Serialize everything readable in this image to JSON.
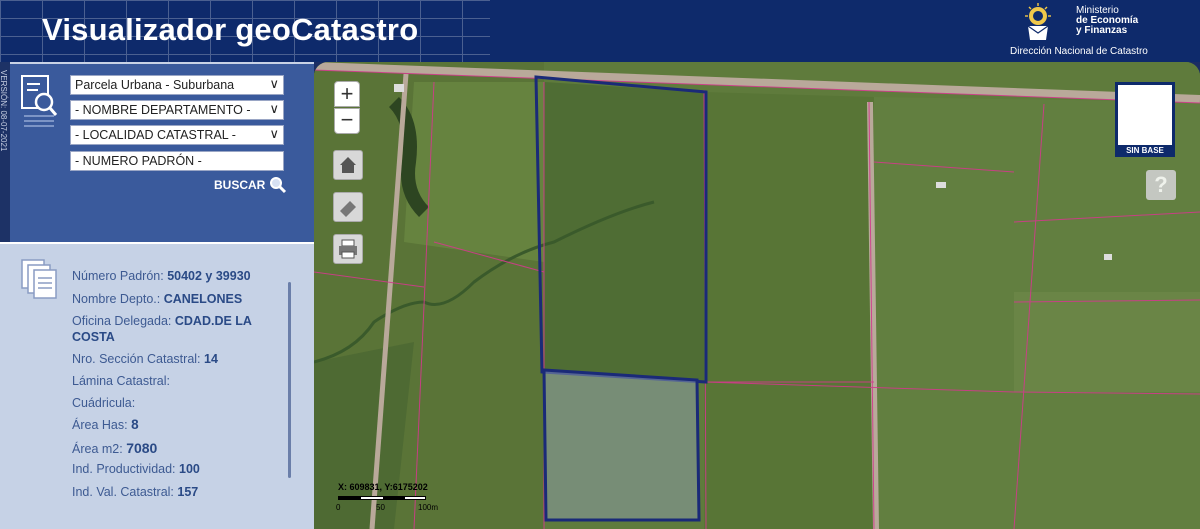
{
  "header": {
    "title": "Visualizador geoCatastro",
    "ministry_line1": "Ministerio",
    "ministry_line2": "de Economía",
    "ministry_line3": "y Finanzas",
    "dept": "Dirección Nacional de Catastro"
  },
  "sidebar": {
    "version": "VERSIÓN: 08-07-2021",
    "filters": [
      {
        "value": "Parcela Urbana - Suburbana",
        "has_dropdown": true
      },
      {
        "value": "- NOMBRE DEPARTAMENTO -",
        "has_dropdown": true
      },
      {
        "value": "- LOCALIDAD CATASTRAL -",
        "has_dropdown": true
      },
      {
        "placeholder": " - NUMERO PADRÓN  -",
        "has_dropdown": false
      }
    ],
    "search_label": "BUSCAR",
    "search_icon": "magnifier-icon"
  },
  "info": {
    "rows": [
      {
        "label": "Número Padrón:",
        "value": "50402 y 39930"
      },
      {
        "label": "Nombre Depto.:",
        "value": "CANELONES"
      },
      {
        "label": "Oficina Delegada:",
        "value": "CDAD.DE LA"
      },
      {
        "label": "",
        "value": "COSTA"
      },
      {
        "label": "Nro. Sección Catastral:",
        "value": "14"
      },
      {
        "label": "Lámina Catastral:",
        "value": ""
      },
      {
        "label": "Cuádricula:",
        "value": ""
      },
      {
        "label": "Área Has:",
        "value": "8"
      },
      {
        "label": "Área m2:",
        "value": "7080"
      },
      {
        "label": "Ind. Productividad:",
        "value": "100"
      },
      {
        "label": "Ind. Val. Catastral:",
        "value": "157"
      }
    ]
  },
  "map": {
    "zoom_in": "+",
    "zoom_out": "−",
    "basemap_label": "SIN BASE",
    "help": "?",
    "coords": "X: 609831, Y:6175202",
    "scale_labels": [
      "0",
      "50",
      "100m"
    ],
    "colors": {
      "parcel_lines": "#d23a8c",
      "selection": "#1a2a78",
      "road": "#b9a99a"
    }
  }
}
